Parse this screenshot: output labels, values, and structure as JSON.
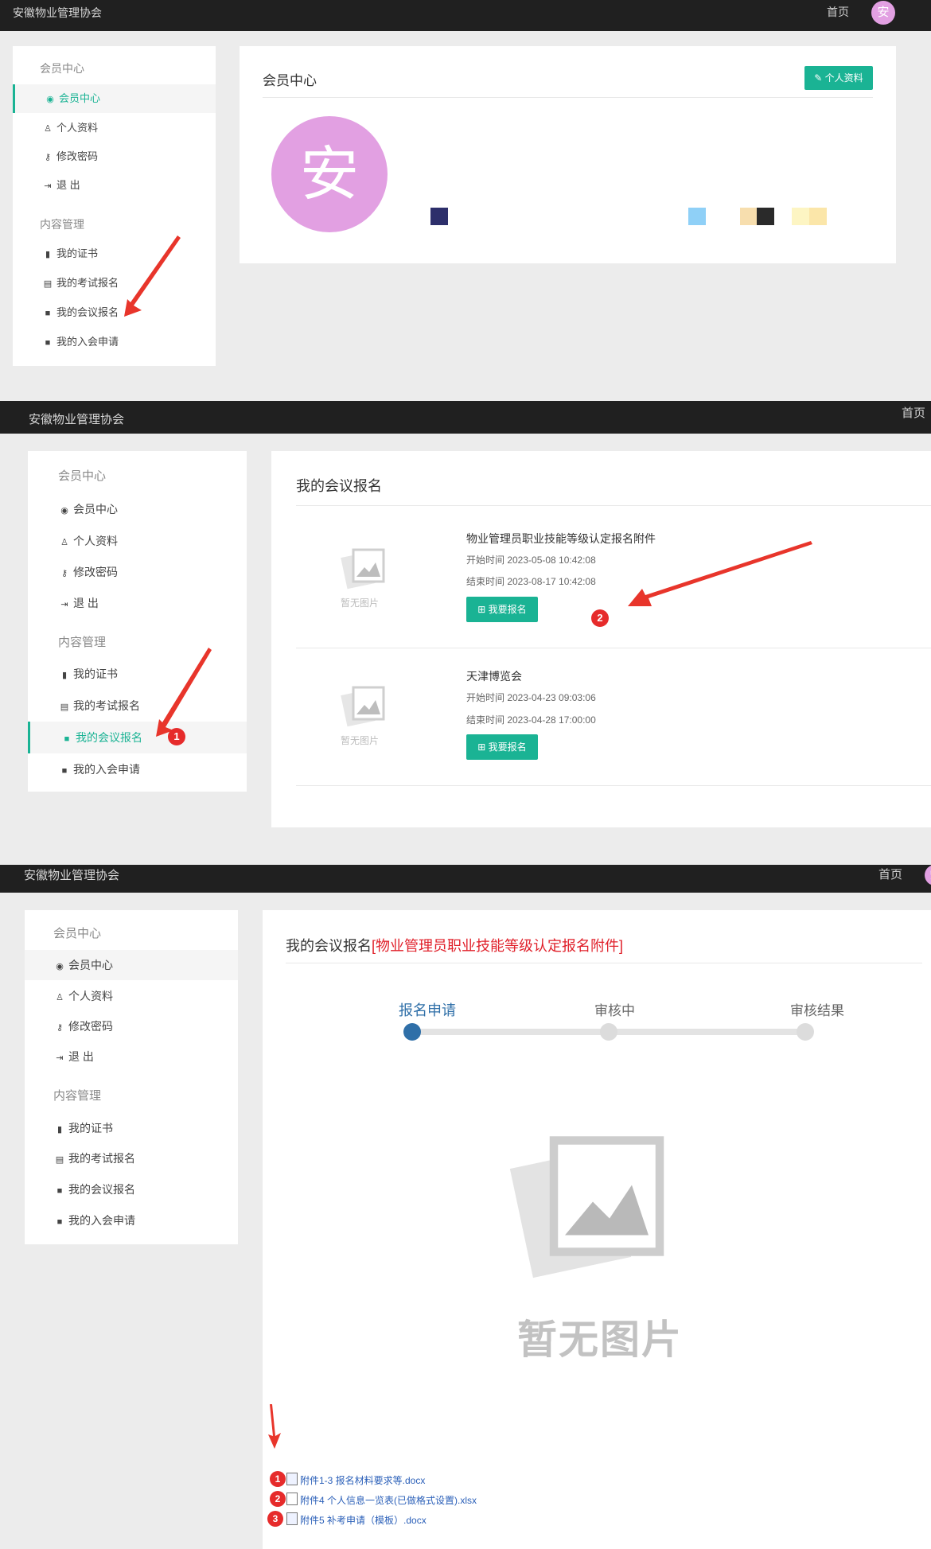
{
  "brand": "安徽物业管理协会",
  "home": "首页",
  "avatar_char": "安",
  "sidebar": {
    "group1": "会员中心",
    "items1": [
      {
        "label": "会员中心",
        "icon": "user-circle-icon"
      },
      {
        "label": "个人资料",
        "icon": "user-icon"
      },
      {
        "label": "修改密码",
        "icon": "key-icon"
      },
      {
        "label": "退 出",
        "icon": "sign-out-icon"
      }
    ],
    "group2": "内容管理",
    "items2": [
      {
        "label": "我的证书",
        "icon": "bookmark-icon"
      },
      {
        "label": "我的考试报名",
        "icon": "id-card-icon"
      },
      {
        "label": "我的会议报名",
        "icon": "shopping-bag-icon"
      },
      {
        "label": "我的入会申请",
        "icon": "shopping-bag-icon"
      }
    ]
  },
  "panel1": {
    "title": "会员中心",
    "edit_button": "✎ 个人资料",
    "swatches": [
      "#2d2f6b",
      "#8fd0f7",
      "#f7deae",
      "#2a2a2a",
      "#fdf5c3",
      "#fbe6a9"
    ]
  },
  "panel2": {
    "title": "我的会议报名",
    "no_image": "暂无图片",
    "register_button": "⊞ 我要报名",
    "events": [
      {
        "title": "物业管理员职业技能等级认定报名附件",
        "start": "开始时间 2023-05-08 10:42:08",
        "end": "结束时间 2023-08-17 10:42:08"
      },
      {
        "title": "天津博览会",
        "start": "开始时间 2023-04-23 09:03:06",
        "end": "结束时间 2023-04-28 17:00:00"
      }
    ]
  },
  "panel3": {
    "title_prefix": "我的会议报名",
    "title_highlight": "[物业管理员职业技能等级认定报名附件]",
    "steps": [
      "报名申请",
      "审核中",
      "审核结果"
    ],
    "no_image": "暂无图片",
    "attachments": [
      "附件1-3 报名材料要求等.docx",
      "附件4 个人信息一览表(已做格式设置).xlsx",
      "附件5 补考申请（模板）.docx"
    ]
  },
  "annotations": [
    "1",
    "2",
    "1",
    "2",
    "3"
  ]
}
